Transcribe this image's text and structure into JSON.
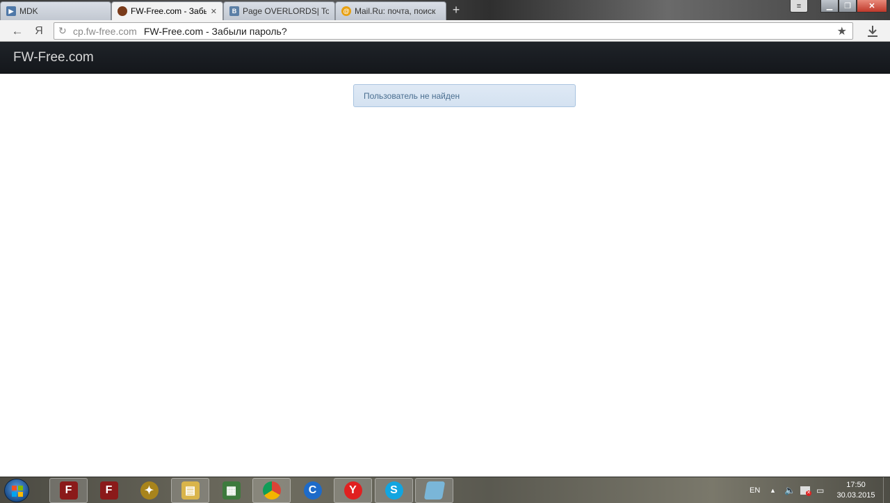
{
  "browser": {
    "tabs": [
      {
        "label": "MDK",
        "favicon": "play-icon",
        "color": "#4f78a8"
      },
      {
        "label": "FW-Free.com - Забыл",
        "favicon": "site-icon",
        "color": "#7a3b1a",
        "close": "✕"
      },
      {
        "label": "Page OVERLORDS| Tok",
        "favicon": "vk-icon",
        "color": "#5b7fa6"
      },
      {
        "label": "Mail.Ru: почта, поиск",
        "favicon": "mailru-icon",
        "color": "#e8a010"
      }
    ],
    "address_domain": "cp.fw-free.com",
    "address_title": "FW-Free.com - Забыли пароль?"
  },
  "site": {
    "brand": "FW-Free.com"
  },
  "alert": {
    "message": "Пользователь не найден"
  },
  "taskbar": {
    "language": "EN",
    "time": "17:50",
    "date": "30.03.2015",
    "apps": [
      {
        "name": "game-launcher-1-icon",
        "color": "#8b1a1a"
      },
      {
        "name": "game-launcher-2-icon",
        "color": "#8b1a1a"
      },
      {
        "name": "game-emblem-icon",
        "color": "#a8841c"
      },
      {
        "name": "file-explorer-icon",
        "color": "#d9b44a"
      },
      {
        "name": "task-manager-icon",
        "color": "#3d7a3d"
      },
      {
        "name": "chrome-icon",
        "color": "#d94b2b"
      },
      {
        "name": "c-browser-icon",
        "color": "#1e6bc9"
      },
      {
        "name": "yandex-browser-icon",
        "color": "#e02020"
      },
      {
        "name": "skype-icon",
        "color": "#12a5e0"
      },
      {
        "name": "notes-icon",
        "color": "#7ab6d8"
      }
    ]
  }
}
